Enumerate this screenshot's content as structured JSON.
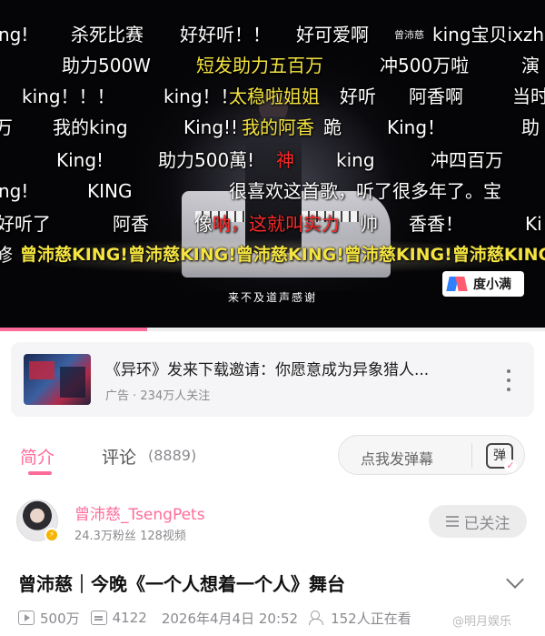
{
  "video": {
    "uploader_watermark": "曾沛慈",
    "caption": "来不及道声感谢",
    "sponsor_badge": "度小满",
    "progress_fraction": 0.27,
    "danmaku": [
      {
        "text": "ng!",
        "color": "white"
      },
      {
        "text": "杀死比赛",
        "color": "white"
      },
      {
        "text": "好好听！！",
        "color": "white"
      },
      {
        "text": "好可爱啊",
        "color": "white"
      },
      {
        "text": "king宝贝ixzh",
        "color": "white"
      },
      {
        "text": "助力500W",
        "color": "white"
      },
      {
        "text": "短发助力五百万",
        "color": "yellow"
      },
      {
        "text": "冲500万啦",
        "color": "white"
      },
      {
        "text": "演",
        "color": "white"
      },
      {
        "text": "king！！！",
        "color": "white"
      },
      {
        "text": "king！！",
        "color": "white"
      },
      {
        "text": "太稳啦姐姐",
        "color": "yellow"
      },
      {
        "text": "好听",
        "color": "white"
      },
      {
        "text": "阿香啊",
        "color": "white"
      },
      {
        "text": "当时",
        "color": "white"
      },
      {
        "text": "万",
        "color": "white"
      },
      {
        "text": "我的king",
        "color": "white"
      },
      {
        "text": "King!!",
        "color": "white"
      },
      {
        "text": "我的阿香",
        "color": "yellow"
      },
      {
        "text": "跪",
        "color": "white"
      },
      {
        "text": "King！",
        "color": "white"
      },
      {
        "text": "助",
        "color": "white"
      },
      {
        "text": "King!",
        "color": "white"
      },
      {
        "text": "助力500萬!",
        "color": "white"
      },
      {
        "text": "神",
        "color": "red"
      },
      {
        "text": "king",
        "color": "white"
      },
      {
        "text": "冲四百万",
        "color": "white"
      },
      {
        "text": "ng!",
        "color": "white"
      },
      {
        "text": "KING",
        "color": "white"
      },
      {
        "text": "很喜欢这首歌，听了很多年了。宝",
        "color": "white"
      },
      {
        "text": "好听了",
        "color": "white"
      },
      {
        "text": "阿香",
        "color": "white"
      },
      {
        "text": "像",
        "color": "white"
      },
      {
        "text": "呐，这就叫实力",
        "color": "red"
      },
      {
        "text": "帅",
        "color": "white"
      },
      {
        "text": "香香！",
        "color": "white"
      },
      {
        "text": "Ki",
        "color": "white"
      },
      {
        "text": "修",
        "color": "white"
      },
      {
        "text": "曾沛慈KING!曾沛慈KING!曾沛慈KING!曾沛慈KING!曾沛慈KING!",
        "color": "yellow"
      }
    ]
  },
  "ad": {
    "title": "《异环》发来下载邀请：你愿意成为异象猎人...",
    "subtitle": "广告 · 234万人关注"
  },
  "tabs": {
    "intro": "简介",
    "comments": "评论",
    "comments_count": "(8889)"
  },
  "danmu_input": {
    "placeholder": "点我发弹幕",
    "icon_label": "弹"
  },
  "uploader": {
    "name": "曾沛慈_TsengPets",
    "stats": "24.3万粉丝  128视频",
    "follow_label": "已关注"
  },
  "video_info": {
    "title": "曾沛慈｜今晚《一个人想着一个人》舞台",
    "plays": "500万",
    "danmaku_count": "4122",
    "date": "2026年4月4日 20:52",
    "watching": "152人正在看"
  },
  "watermark": "@明月娱乐",
  "colors": {
    "accent": "#ff6c9a",
    "danmaku_yellow": "#f4e340",
    "danmaku_red": "#ff2a2a"
  }
}
